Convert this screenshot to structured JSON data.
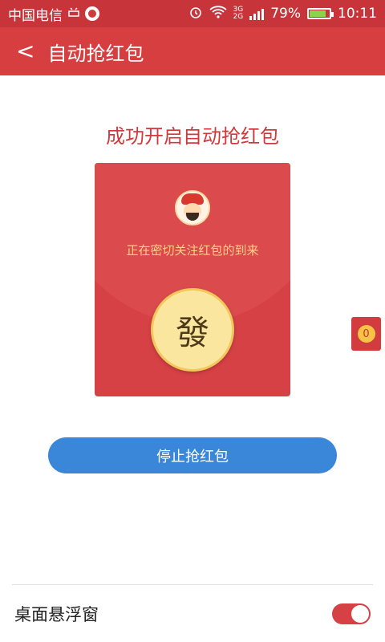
{
  "status_bar": {
    "carrier": "中国电信",
    "network_top": "3G",
    "network_bottom": "2G",
    "battery_percent": "79%",
    "time": "10:11"
  },
  "app_bar": {
    "back_label": "<",
    "title": "自动抢红包"
  },
  "main": {
    "success_title": "成功开启自动抢红包",
    "envelope": {
      "watching_text": "正在密切关注红包的到来",
      "open_button_label": "發"
    },
    "stop_button_label": "停止抢红包"
  },
  "floating_widget": {
    "count": "0"
  },
  "settings": {
    "desktop_float_label": "桌面悬浮窗",
    "desktop_float_enabled": true
  },
  "colors": {
    "primary_red": "#d63e3f",
    "blue": "#3a86d8",
    "gold": "#fbe6a0"
  }
}
